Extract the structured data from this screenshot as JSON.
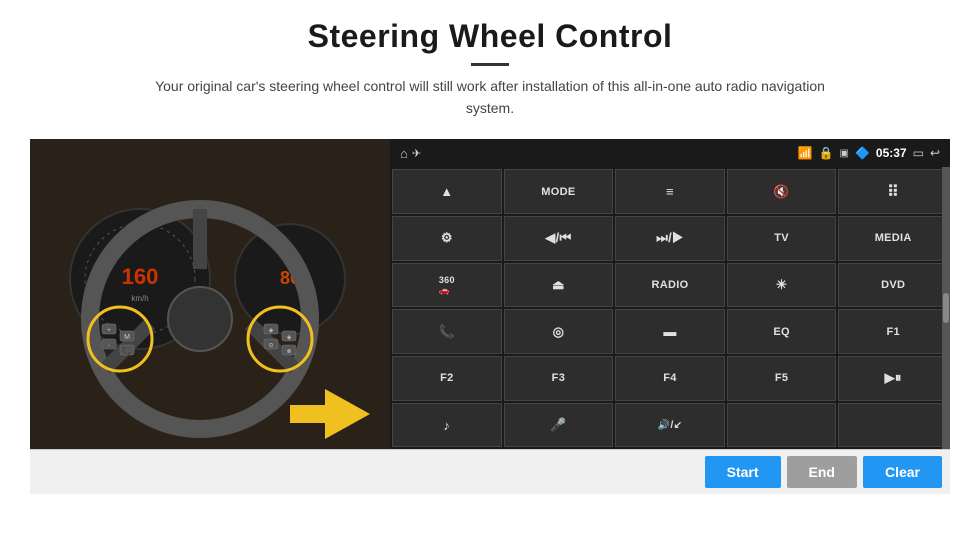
{
  "page": {
    "title": "Steering Wheel Control",
    "subtitle": "Your original car's steering wheel control will still work after installation of this all-in-one auto radio navigation system."
  },
  "status_bar": {
    "time": "05:37",
    "icons": [
      "home",
      "wifi",
      "lock",
      "sd",
      "bluetooth",
      "cast",
      "back"
    ]
  },
  "buttons": [
    {
      "row": 1,
      "col": 1,
      "label": "▲",
      "type": "icon",
      "id": "nav-up"
    },
    {
      "row": 1,
      "col": 2,
      "label": "MODE",
      "type": "text",
      "id": "mode"
    },
    {
      "row": 1,
      "col": 3,
      "label": "≡",
      "type": "icon",
      "id": "menu"
    },
    {
      "row": 1,
      "col": 4,
      "label": "🔇",
      "type": "icon",
      "id": "mute"
    },
    {
      "row": 1,
      "col": 5,
      "label": "⠿",
      "type": "icon",
      "id": "apps"
    },
    {
      "row": 2,
      "col": 1,
      "label": "⚙",
      "type": "icon",
      "id": "settings"
    },
    {
      "row": 2,
      "col": 2,
      "label": "◀/⏮",
      "type": "icon",
      "id": "prev"
    },
    {
      "row": 2,
      "col": 3,
      "label": "⏭/▶",
      "type": "icon",
      "id": "next"
    },
    {
      "row": 2,
      "col": 4,
      "label": "TV",
      "type": "text",
      "id": "tv"
    },
    {
      "row": 2,
      "col": 5,
      "label": "MEDIA",
      "type": "text",
      "id": "media"
    },
    {
      "row": 3,
      "col": 1,
      "label": "360",
      "type": "text",
      "id": "360cam"
    },
    {
      "row": 3,
      "col": 2,
      "label": "▲",
      "type": "icon",
      "id": "eject"
    },
    {
      "row": 3,
      "col": 3,
      "label": "RADIO",
      "type": "text",
      "id": "radio"
    },
    {
      "row": 3,
      "col": 4,
      "label": "☀",
      "type": "icon",
      "id": "brightness"
    },
    {
      "row": 3,
      "col": 5,
      "label": "DVD",
      "type": "text",
      "id": "dvd"
    },
    {
      "row": 4,
      "col": 1,
      "label": "📞",
      "type": "icon",
      "id": "phone"
    },
    {
      "row": 4,
      "col": 2,
      "label": "◎",
      "type": "icon",
      "id": "navi"
    },
    {
      "row": 4,
      "col": 3,
      "label": "▬",
      "type": "icon",
      "id": "mirror"
    },
    {
      "row": 4,
      "col": 4,
      "label": "EQ",
      "type": "text",
      "id": "eq"
    },
    {
      "row": 4,
      "col": 5,
      "label": "F1",
      "type": "text",
      "id": "f1"
    },
    {
      "row": 5,
      "col": 1,
      "label": "F2",
      "type": "text",
      "id": "f2"
    },
    {
      "row": 5,
      "col": 2,
      "label": "F3",
      "type": "text",
      "id": "f3"
    },
    {
      "row": 5,
      "col": 3,
      "label": "F4",
      "type": "text",
      "id": "f4"
    },
    {
      "row": 5,
      "col": 4,
      "label": "F5",
      "type": "text",
      "id": "f5"
    },
    {
      "row": 5,
      "col": 5,
      "label": "▶⏸",
      "type": "icon",
      "id": "play-pause"
    },
    {
      "row": 6,
      "col": 1,
      "label": "♪",
      "type": "icon",
      "id": "music"
    },
    {
      "row": 6,
      "col": 2,
      "label": "🎤",
      "type": "icon",
      "id": "mic"
    },
    {
      "row": 6,
      "col": 3,
      "label": "🔊/↙",
      "type": "icon",
      "id": "vol-phone"
    },
    {
      "row": 6,
      "col": 4,
      "label": "",
      "type": "empty",
      "id": "empty1"
    },
    {
      "row": 6,
      "col": 5,
      "label": "",
      "type": "empty",
      "id": "empty2"
    }
  ],
  "action_bar": {
    "start_label": "Start",
    "end_label": "End",
    "clear_label": "Clear"
  }
}
